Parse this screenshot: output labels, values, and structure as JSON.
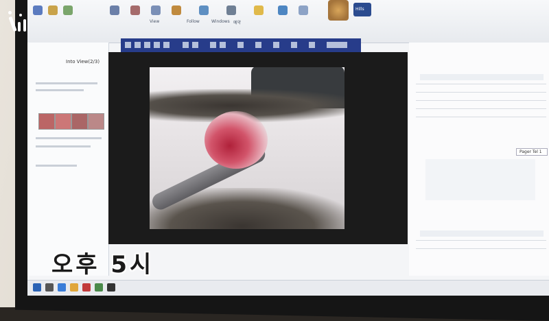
{
  "caption": {
    "text": "오후 5시"
  },
  "ribbon": {
    "tab_labels": [
      "Follow",
      "Windows",
      "예약",
      "View"
    ]
  },
  "title_bar": {
    "text": "Into View(2/3)"
  },
  "right_panel": {
    "label": "Pager Tel 1"
  },
  "brand": {
    "hills_label": "Hills"
  },
  "icons": [
    "logo-icon",
    "photo-icon",
    "start-icon"
  ],
  "colors": {
    "toolbar": "#273c8a",
    "wound": "#b0213a",
    "screen_bg": "#f4f5f7"
  }
}
